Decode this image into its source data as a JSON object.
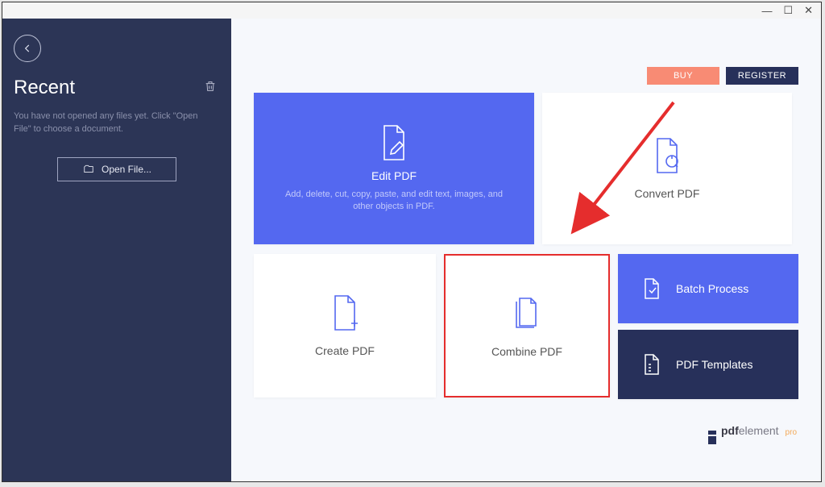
{
  "window": {
    "minimize": "—",
    "maximize": "☐",
    "close": "✕"
  },
  "sidebar": {
    "recent_title": "Recent",
    "hint": "You have not opened any files yet. Click \"Open File\" to choose a document.",
    "open_file_label": "Open File..."
  },
  "actions": {
    "buy": "BUY",
    "register": "REGISTER"
  },
  "tiles": {
    "edit": {
      "title": "Edit PDF",
      "sub": "Add, delete, cut, copy, paste, and edit text, images, and other objects in PDF."
    },
    "convert": {
      "title": "Convert PDF"
    },
    "create": {
      "title": "Create PDF"
    },
    "combine": {
      "title": "Combine PDF"
    },
    "batch": {
      "title": "Batch Process"
    },
    "templates": {
      "title": "PDF Templates"
    }
  },
  "brand": {
    "strong": "pdf",
    "light": "element",
    "suffix": "pro"
  }
}
